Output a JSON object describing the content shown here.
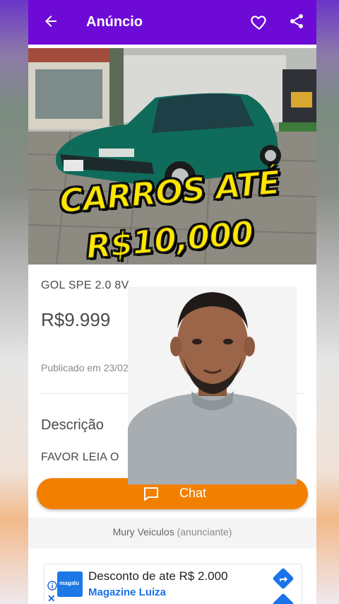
{
  "appbar": {
    "title": "Anúncio",
    "color": "#6e0ad6"
  },
  "listing": {
    "title": "GOL SPE   2.0 8V",
    "price": "R$9.999",
    "published": "Publicado em 23/02 às 22:3",
    "description_heading": "Descrição",
    "description_text": "FAVOR LEIA O"
  },
  "actions": {
    "chat_label": "Chat",
    "chat_color": "#f28000"
  },
  "seller": {
    "name": "Mury Veiculos",
    "role": "(anunciante)"
  },
  "ad": {
    "headline": "Desconto de ate R$ 2.000",
    "brand": "Magazine Luiza",
    "logo_text": "magalu",
    "close": "✕"
  },
  "overlay": {
    "line1": "CARROS ATÉ",
    "line2": "R$10,000",
    "color": "#ffe600"
  },
  "icons": [
    "back-arrow-icon",
    "heart-icon",
    "share-icon",
    "chat-bubble-icon",
    "info-icon",
    "close-icon",
    "directions-icon"
  ]
}
